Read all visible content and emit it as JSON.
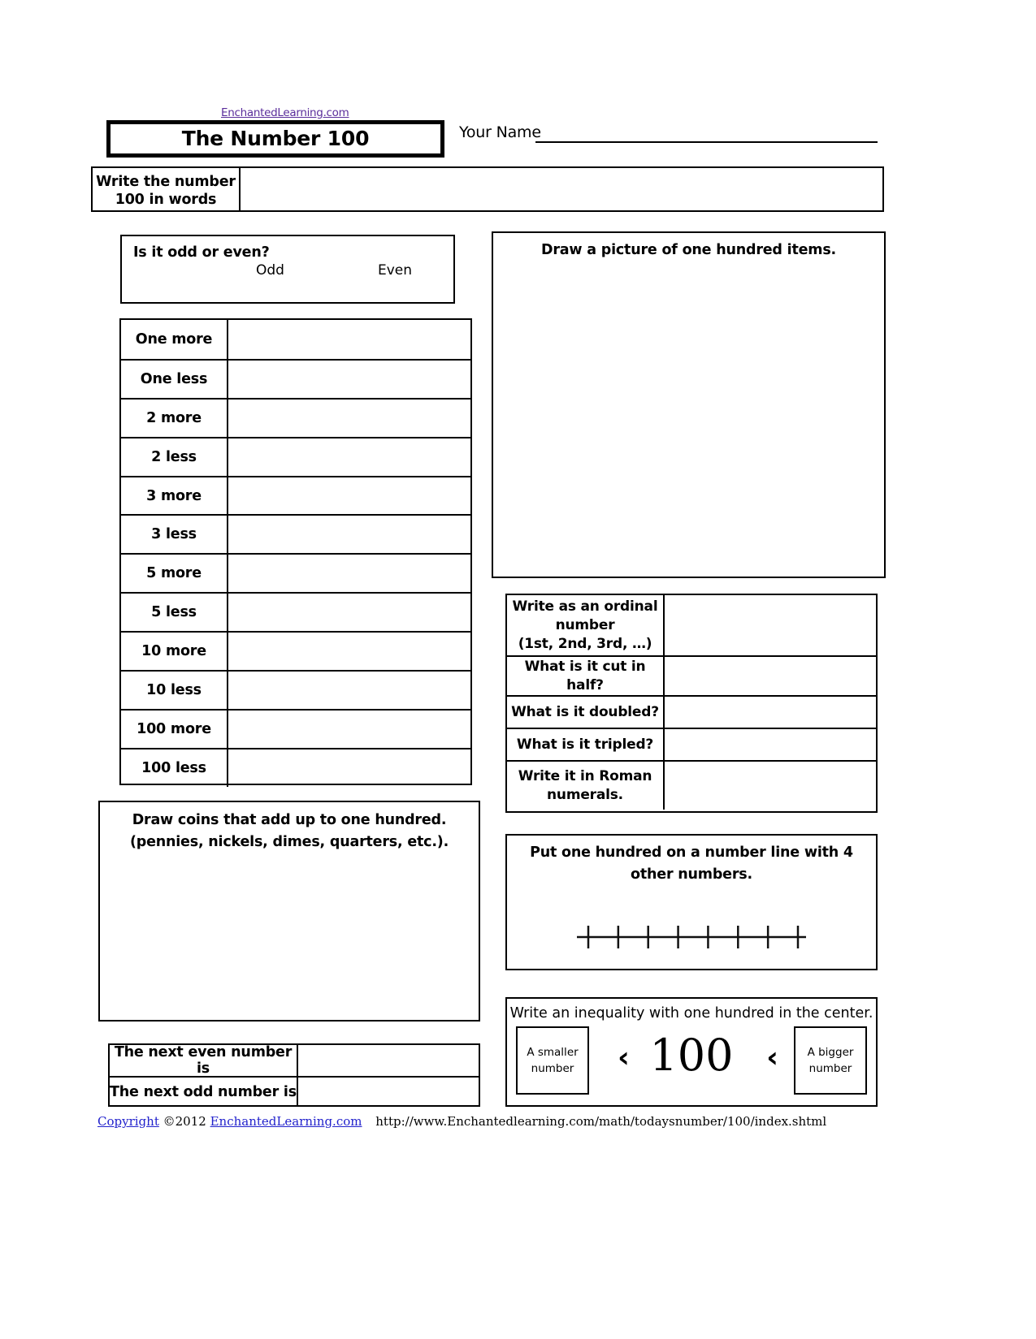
{
  "header": {
    "site_link": "EnchantedLearning.com",
    "title": "The Number 100",
    "name_label": "Your Name"
  },
  "words_row": {
    "label": "Write the number 100 in words",
    "value": ""
  },
  "odd_even": {
    "question": "Is it odd or even?",
    "option_odd": "Odd",
    "option_even": "Even"
  },
  "more_less": {
    "rows": [
      {
        "label": "One more",
        "value": ""
      },
      {
        "label": "One less",
        "value": ""
      },
      {
        "label": "2 more",
        "value": ""
      },
      {
        "label": "2 less",
        "value": ""
      },
      {
        "label": "3 more",
        "value": ""
      },
      {
        "label": "3 less",
        "value": ""
      },
      {
        "label": "5 more",
        "value": ""
      },
      {
        "label": "5 less",
        "value": ""
      },
      {
        "label": "10 more",
        "value": ""
      },
      {
        "label": "10 less",
        "value": ""
      },
      {
        "label": "100 more",
        "value": ""
      },
      {
        "label": "100 less",
        "value": ""
      }
    ]
  },
  "draw_picture": {
    "title": "Draw a picture of one hundred items."
  },
  "ordinal_table": {
    "rows": [
      {
        "label": "Write as an ordinal number\n(1st, 2nd, 3rd, …)",
        "value": ""
      },
      {
        "label": "What is it cut in half?",
        "value": ""
      },
      {
        "label": "What is it doubled?",
        "value": ""
      },
      {
        "label": "What is it tripled?",
        "value": ""
      },
      {
        "label": "Write it in Roman numerals.",
        "value": ""
      }
    ]
  },
  "draw_coins": {
    "title": "Draw coins that add up to one hundred.\n(pennies, nickels, dimes, quarters, etc.)."
  },
  "number_line": {
    "title": "Put one hundred on a number line with 4 other numbers.",
    "tick_count": 8
  },
  "next_numbers": {
    "rows": [
      {
        "label": "The next even number is",
        "value": ""
      },
      {
        "label": "The next odd number is",
        "value": ""
      }
    ]
  },
  "inequality": {
    "title": "Write an inequality with one hundred in the center.",
    "left_box_label": "A smaller number",
    "right_box_label": "A bigger number",
    "center_value": "100",
    "operator_left": "‹",
    "operator_right": "‹"
  },
  "footer": {
    "copyright_word": "Copyright",
    "year": "©2012",
    "site": "EnchantedLearning.com",
    "url": "http://www.Enchantedlearning.com/math/todaysnumber/100/index.shtml"
  },
  "colors": {
    "link": "#5a2d9b",
    "footer_link": "#2222cc",
    "border": "#000000"
  }
}
